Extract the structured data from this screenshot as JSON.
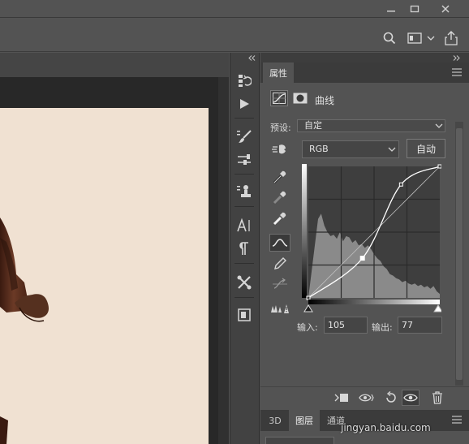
{
  "window": {
    "minimize_icon": "minimize-icon",
    "maximize_icon": "maximize-icon",
    "close_icon": "close-icon"
  },
  "options_bar": {
    "icons": [
      "search-icon",
      "workspace-icon",
      "chevron-down-icon",
      "share-icon"
    ]
  },
  "tool_column": {
    "icons": [
      "history-icon",
      "play-actions-icon",
      "brush-presets-icon",
      "tool-presets-icon",
      "clone-source-icon",
      "character-icon",
      "paragraph-icon",
      "tools-icon",
      "libraries-icon"
    ]
  },
  "properties": {
    "tab_label": "属性",
    "title": "曲线",
    "preset_label": "预设:",
    "preset_value": "自定",
    "channel": "RGB",
    "auto_label": "自动",
    "input_label": "输入:",
    "input_value": "105",
    "output_label": "输出:",
    "output_value": "77",
    "side_tools": [
      "on-image-adjust-icon",
      "black-point-eyedropper-icon",
      "gray-point-eyedropper-icon",
      "white-point-eyedropper-icon",
      "curve-point-tool-icon",
      "pencil-draw-icon",
      "smooth-curve-icon",
      "clipping-warning-icon"
    ],
    "bottom_icons": [
      "clip-to-layer-icon",
      "view-previous-icon",
      "reset-icon",
      "visibility-eye-icon",
      "delete-icon"
    ]
  },
  "curve": {
    "points": [
      [
        0,
        0
      ],
      [
        105,
        77
      ],
      [
        180,
        220
      ],
      [
        255,
        255
      ]
    ],
    "colors": {
      "curve": "#ffffff",
      "baseline": "#bdbdbd",
      "histogram": "#8a8a8a",
      "graph_bg": "#3e3e3e"
    }
  },
  "layers_panel": {
    "tabs": [
      "3D",
      "图层",
      "通道"
    ],
    "active_tab": "图层"
  },
  "watermark": "jingyan.baidu.com"
}
